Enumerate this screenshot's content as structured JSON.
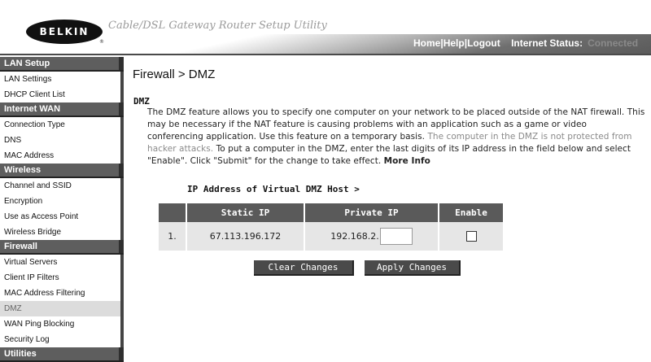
{
  "brand": {
    "logo_text": "BELKIN",
    "registered_mark": "®"
  },
  "app_title": "Cable/DSL Gateway Router Setup Utility",
  "top_nav": {
    "home": "Home",
    "sep1": "|",
    "help": "Help",
    "sep2": "|",
    "logout": "Logout",
    "status_label": "Internet Status:",
    "status_value": "Connected"
  },
  "sidebar": {
    "sections": [
      {
        "title": "LAN Setup",
        "items": [
          "LAN Settings",
          "DHCP Client List"
        ]
      },
      {
        "title": "Internet WAN",
        "items": [
          "Connection Type",
          "DNS",
          "MAC Address"
        ]
      },
      {
        "title": "Wireless",
        "items": [
          "Channel and SSID",
          "Encryption",
          "Use as Access Point",
          "Wireless Bridge"
        ]
      },
      {
        "title": "Firewall",
        "items": [
          "Virtual Servers",
          "Client IP Filters",
          "MAC Address Filtering",
          "DMZ",
          "WAN Ping Blocking",
          "Security Log"
        ]
      },
      {
        "title": "Utilities"
      }
    ],
    "active_item": "DMZ"
  },
  "main": {
    "page_title": "Firewall > DMZ",
    "section_title": "DMZ",
    "description": {
      "part1": "The DMZ feature allows you to specify one computer on your network to be placed outside of the NAT firewall. This may be necessary if the NAT feature is causing problems with an application such as a game or video conferencing application. Use this feature on a temporary basis.",
      "part2": "The computer in the DMZ is not protected from hacker attacks.",
      "part3": "To put a computer in the DMZ, enter the last digits of its IP address in the field below and select \"Enable\". Click \"Submit\" for the change to take effect.",
      "more_info": "More Info"
    },
    "host_label": "IP Address of Virtual DMZ Host >",
    "table": {
      "headers": [
        "",
        "Static IP",
        "Private IP",
        "Enable"
      ],
      "row": {
        "index": "1.",
        "static_ip": "67.113.196.172",
        "private_ip_prefix": "192.168.2.",
        "private_ip_value": "",
        "enabled": false
      }
    },
    "buttons": {
      "clear": "Clear Changes",
      "apply": "Apply Changes"
    }
  }
}
